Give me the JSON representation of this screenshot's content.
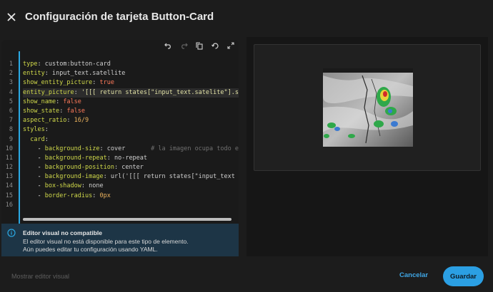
{
  "dialog": {
    "title": "Configuración de tarjeta Button-Card",
    "close_icon": "close-icon"
  },
  "editor": {
    "toolbar": [
      "undo-icon",
      "redo-icon",
      "copy-icon",
      "restore-icon",
      "expand-icon"
    ],
    "line_numbers": [
      "1",
      "2",
      "3",
      "4",
      "5",
      "6",
      "7",
      "8",
      "9",
      "10",
      "11",
      "12",
      "13",
      "14",
      "15",
      "16"
    ],
    "folds": [
      "",
      "",
      "",
      "",
      "",
      "",
      "",
      "∨",
      "∨",
      "",
      "",
      "",
      "",
      "",
      "",
      ""
    ],
    "lines": [
      {
        "indent": "",
        "key": "type",
        "value": "custom:button-card",
        "vtype": "v"
      },
      {
        "indent": "",
        "key": "entity",
        "value": "input_text.satellite",
        "vtype": "v"
      },
      {
        "indent": "",
        "key": "show_entity_picture",
        "value": "true",
        "vtype": "b"
      },
      {
        "indent": "",
        "key": "entity_picture",
        "value": "'[[[ return states[\"input_text.satelite\"].s",
        "vtype": "s"
      },
      {
        "indent": "",
        "key": "show_name",
        "value": "false",
        "vtype": "b"
      },
      {
        "indent": "",
        "key": "show_state",
        "value": "false",
        "vtype": "b"
      },
      {
        "indent": "",
        "key": "aspect_ratio",
        "value": "16/9",
        "vtype": "n"
      },
      {
        "indent": "",
        "key": "styles",
        "value": "",
        "vtype": "v"
      },
      {
        "indent": "  ",
        "key": "card",
        "value": "",
        "vtype": "v"
      },
      {
        "indent": "    - ",
        "key": "background-size",
        "value": "cover       # la imagen ocupa todo el",
        "vtype": "mixed_comment"
      },
      {
        "indent": "    - ",
        "key": "background-repeat",
        "value": "no-repeat",
        "vtype": "v"
      },
      {
        "indent": "    - ",
        "key": "background-position",
        "value": "center",
        "vtype": "v"
      },
      {
        "indent": "    - ",
        "key": "background-image",
        "value": "url('[[[ return states[\"input_text",
        "vtype": "v"
      },
      {
        "indent": "    - ",
        "key": "box-shadow",
        "value": "none",
        "vtype": "v"
      },
      {
        "indent": "    - ",
        "key": "border-radius",
        "value": "0px",
        "vtype": "n"
      },
      {
        "indent": "",
        "key": "",
        "value": "",
        "vtype": "v"
      }
    ],
    "highlighted_line": 4
  },
  "warning": {
    "icon": "info-icon",
    "title": "Editor visual no compatible",
    "line1": "El editor visual no está disponible para este tipo de elemento.",
    "line2": "Aún puedes editar tu configuración usando YAML."
  },
  "preview": {
    "image": "satellite-image"
  },
  "footer": {
    "show_visual_editor": "Mostrar editor visual",
    "cancel": "Cancelar",
    "save": "Guardar"
  },
  "colors": {
    "accent": "#2b9fe3",
    "info_bg": "#1d3546"
  }
}
